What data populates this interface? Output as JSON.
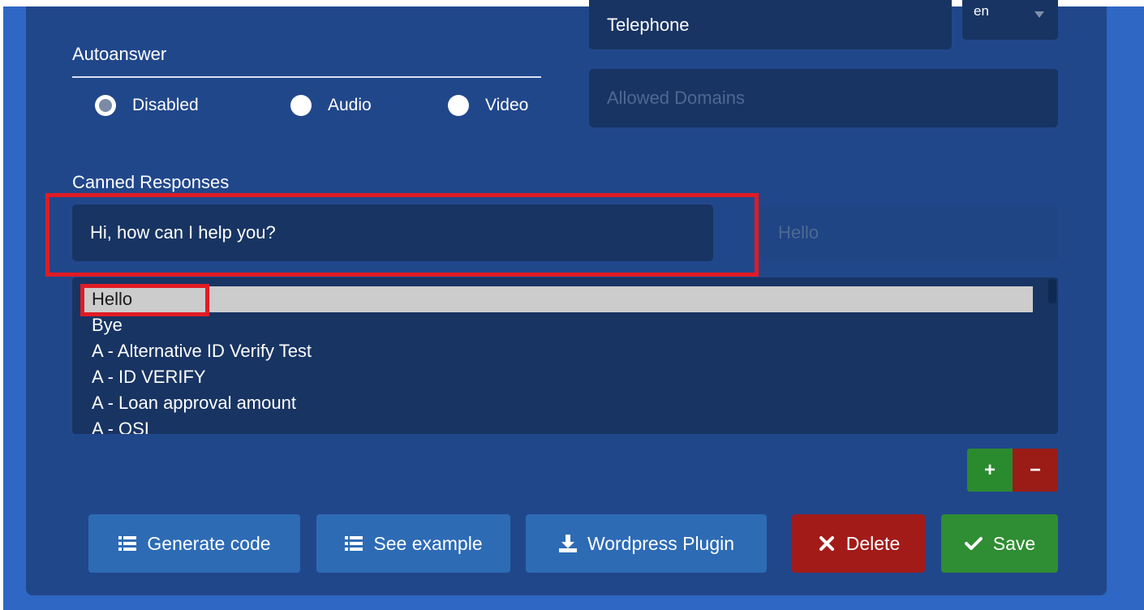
{
  "autoanswer": {
    "label": "Autoanswer",
    "options": [
      {
        "label": "Disabled",
        "checked": true
      },
      {
        "label": "Audio",
        "checked": false
      },
      {
        "label": "Video",
        "checked": false
      }
    ]
  },
  "telephone": {
    "value": "Telephone"
  },
  "language": {
    "value": "en"
  },
  "allowed_domains": {
    "placeholder": "Allowed Domains"
  },
  "canned": {
    "label": "Canned Responses",
    "response_value": "Hi, how can I help you?",
    "title_placeholder": "Hello",
    "items": [
      "Hello",
      "Bye",
      "A - Alternative ID Verify Test",
      "A - ID VERIFY",
      "A - Loan approval amount",
      "A - OSI"
    ]
  },
  "controls": {
    "plus": "+",
    "minus": "−"
  },
  "buttons": {
    "generate_code": "Generate code",
    "see_example": "See example",
    "wordpress_plugin": "Wordpress Plugin",
    "delete": "Delete",
    "save": "Save"
  },
  "colors": {
    "panel": "#21478b",
    "input": "#183463",
    "accent_blue": "#2d6bb5",
    "delete_red": "#a21b19",
    "save_green": "#2f8d33",
    "highlight_red": "#e01b24"
  }
}
